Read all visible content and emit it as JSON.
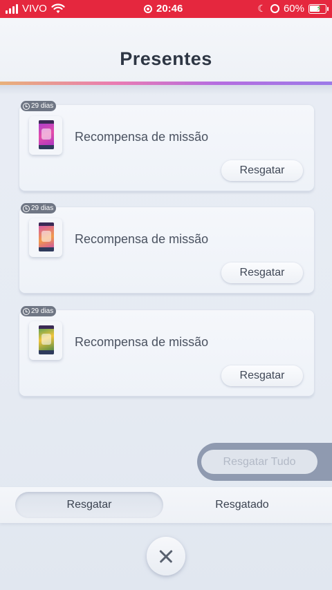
{
  "status_bar": {
    "carrier": "VIVO",
    "time": "20:46",
    "battery": "60%",
    "icons": [
      "signal-icon",
      "wifi-icon",
      "screen-record-icon",
      "moon-icon",
      "rotation-lock-icon",
      "battery-charging-icon"
    ]
  },
  "header": {
    "title": "Presentes"
  },
  "gifts": [
    {
      "days": "29 dias",
      "title": "Recompensa de missão",
      "button": "Resgatar",
      "pack_color": "#a33bd2"
    },
    {
      "days": "29 dias",
      "title": "Recompensa de missão",
      "button": "Resgatar",
      "pack_color": "#d04fb5"
    },
    {
      "days": "29 dias",
      "title": "Recompensa de missão",
      "button": "Resgatar",
      "pack_color": "#f2c43a"
    }
  ],
  "claim_all": {
    "label": "Resgatar Tudo",
    "enabled": false
  },
  "tabs": [
    {
      "label": "Resgatar",
      "active": true
    },
    {
      "label": "Resgatado",
      "active": false
    }
  ],
  "colors": {
    "status_bar": "#e5273e",
    "accent_stripe_start": "#e8b07a",
    "accent_stripe_end": "#9c7ae8",
    "badge": "#6f7684"
  }
}
